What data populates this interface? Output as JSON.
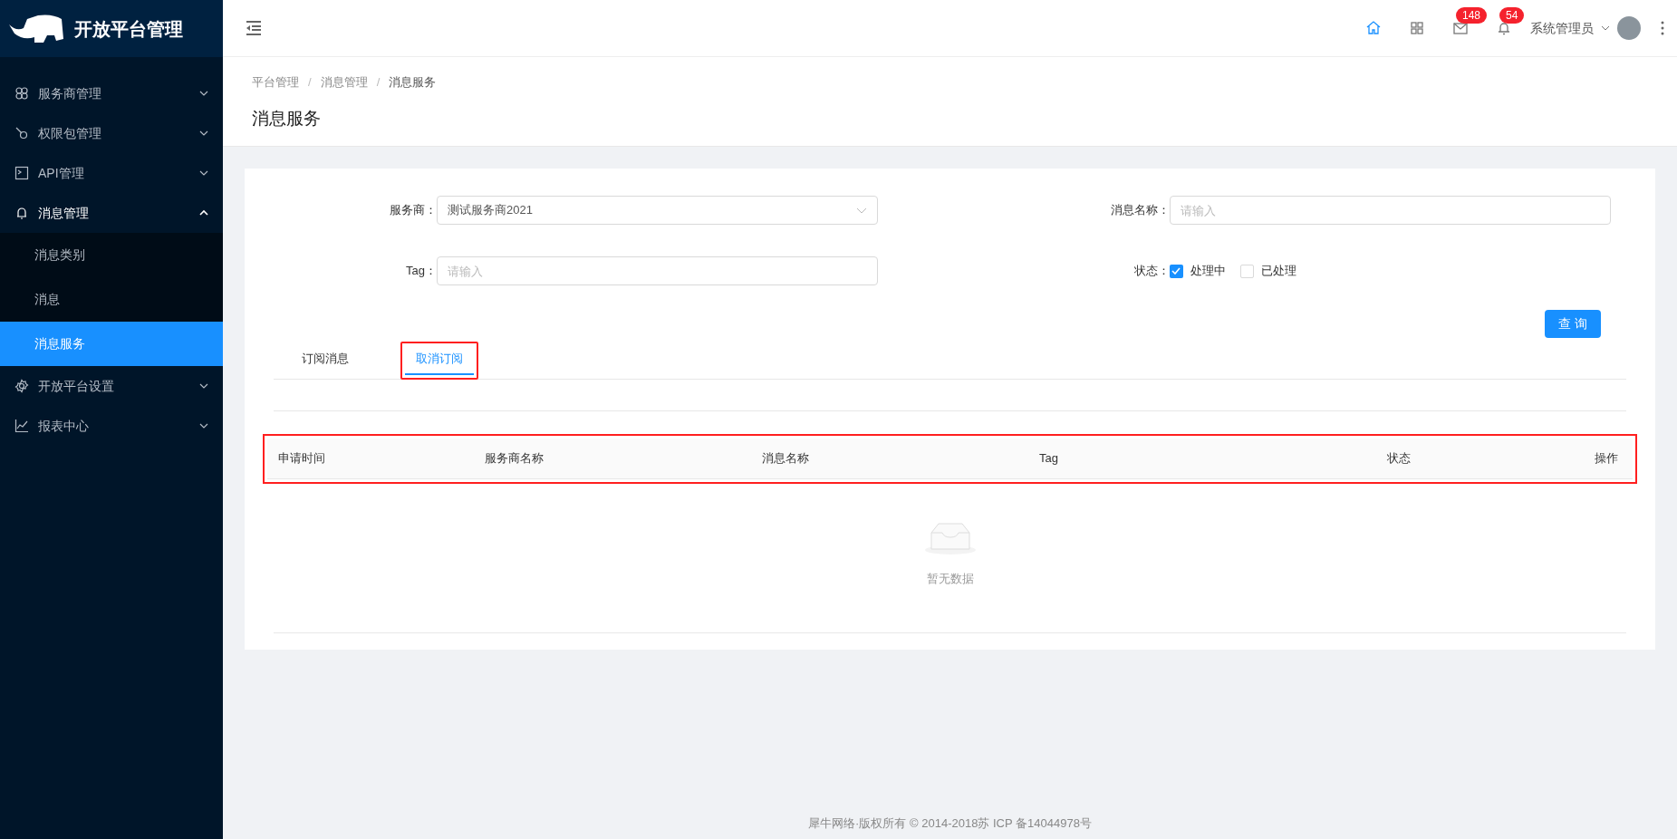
{
  "sidebar": {
    "brand": "开放平台管理",
    "items": [
      {
        "label": "服务商管理",
        "kind": "nodes",
        "expanded": false
      },
      {
        "label": "权限包管理",
        "kind": "key",
        "expanded": false
      },
      {
        "label": "API管理",
        "kind": "terminal",
        "expanded": false
      },
      {
        "label": "消息管理",
        "kind": "bell",
        "expanded": true,
        "children": [
          {
            "label": "消息类别",
            "selected": false
          },
          {
            "label": "消息",
            "selected": false
          },
          {
            "label": "消息服务",
            "selected": true
          }
        ]
      },
      {
        "label": "开放平台设置",
        "kind": "gear",
        "expanded": false
      },
      {
        "label": "报表中心",
        "kind": "chart",
        "expanded": false
      }
    ]
  },
  "header": {
    "icons": [
      {
        "kind": "home",
        "active": true
      },
      {
        "kind": "grid",
        "active": false
      },
      {
        "kind": "mail",
        "active": false,
        "badge": "148"
      },
      {
        "kind": "bell",
        "active": false,
        "badge": "54"
      }
    ],
    "user": "系统管理员"
  },
  "breadcrumb": [
    {
      "kind": "link",
      "text": "平台管理"
    },
    {
      "kind": "separator",
      "text": "/"
    },
    {
      "kind": "link",
      "text": "消息管理"
    },
    {
      "kind": "separator",
      "text": "/"
    },
    {
      "kind": "current",
      "text": "消息服务"
    }
  ],
  "page_title": "消息服务",
  "form": {
    "provider": {
      "label": "服务商：",
      "value": "测试服务商2021"
    },
    "message_name": {
      "label": "消息名称：",
      "placeholder": "请输入"
    },
    "tag": {
      "label": "Tag：",
      "placeholder": "请输入"
    },
    "status": {
      "label": "状态：",
      "options": [
        {
          "label": "处理中",
          "checked": true
        },
        {
          "label": "已处理",
          "checked": false
        }
      ]
    },
    "query_button": "查 询"
  },
  "tabs": [
    {
      "label": "订阅消息",
      "selected": false,
      "highlighted": false
    },
    {
      "label": "取消订阅",
      "selected": true,
      "highlighted": true
    }
  ],
  "table": {
    "highlighted": true,
    "columns": [
      "申请时间",
      "服务商名称",
      "消息名称",
      "Tag",
      "状态",
      "操作"
    ],
    "empty_text": "暂无数据"
  },
  "footer": "犀牛网络·版权所有 © 2014-2018苏 ICP 备14044978号"
}
